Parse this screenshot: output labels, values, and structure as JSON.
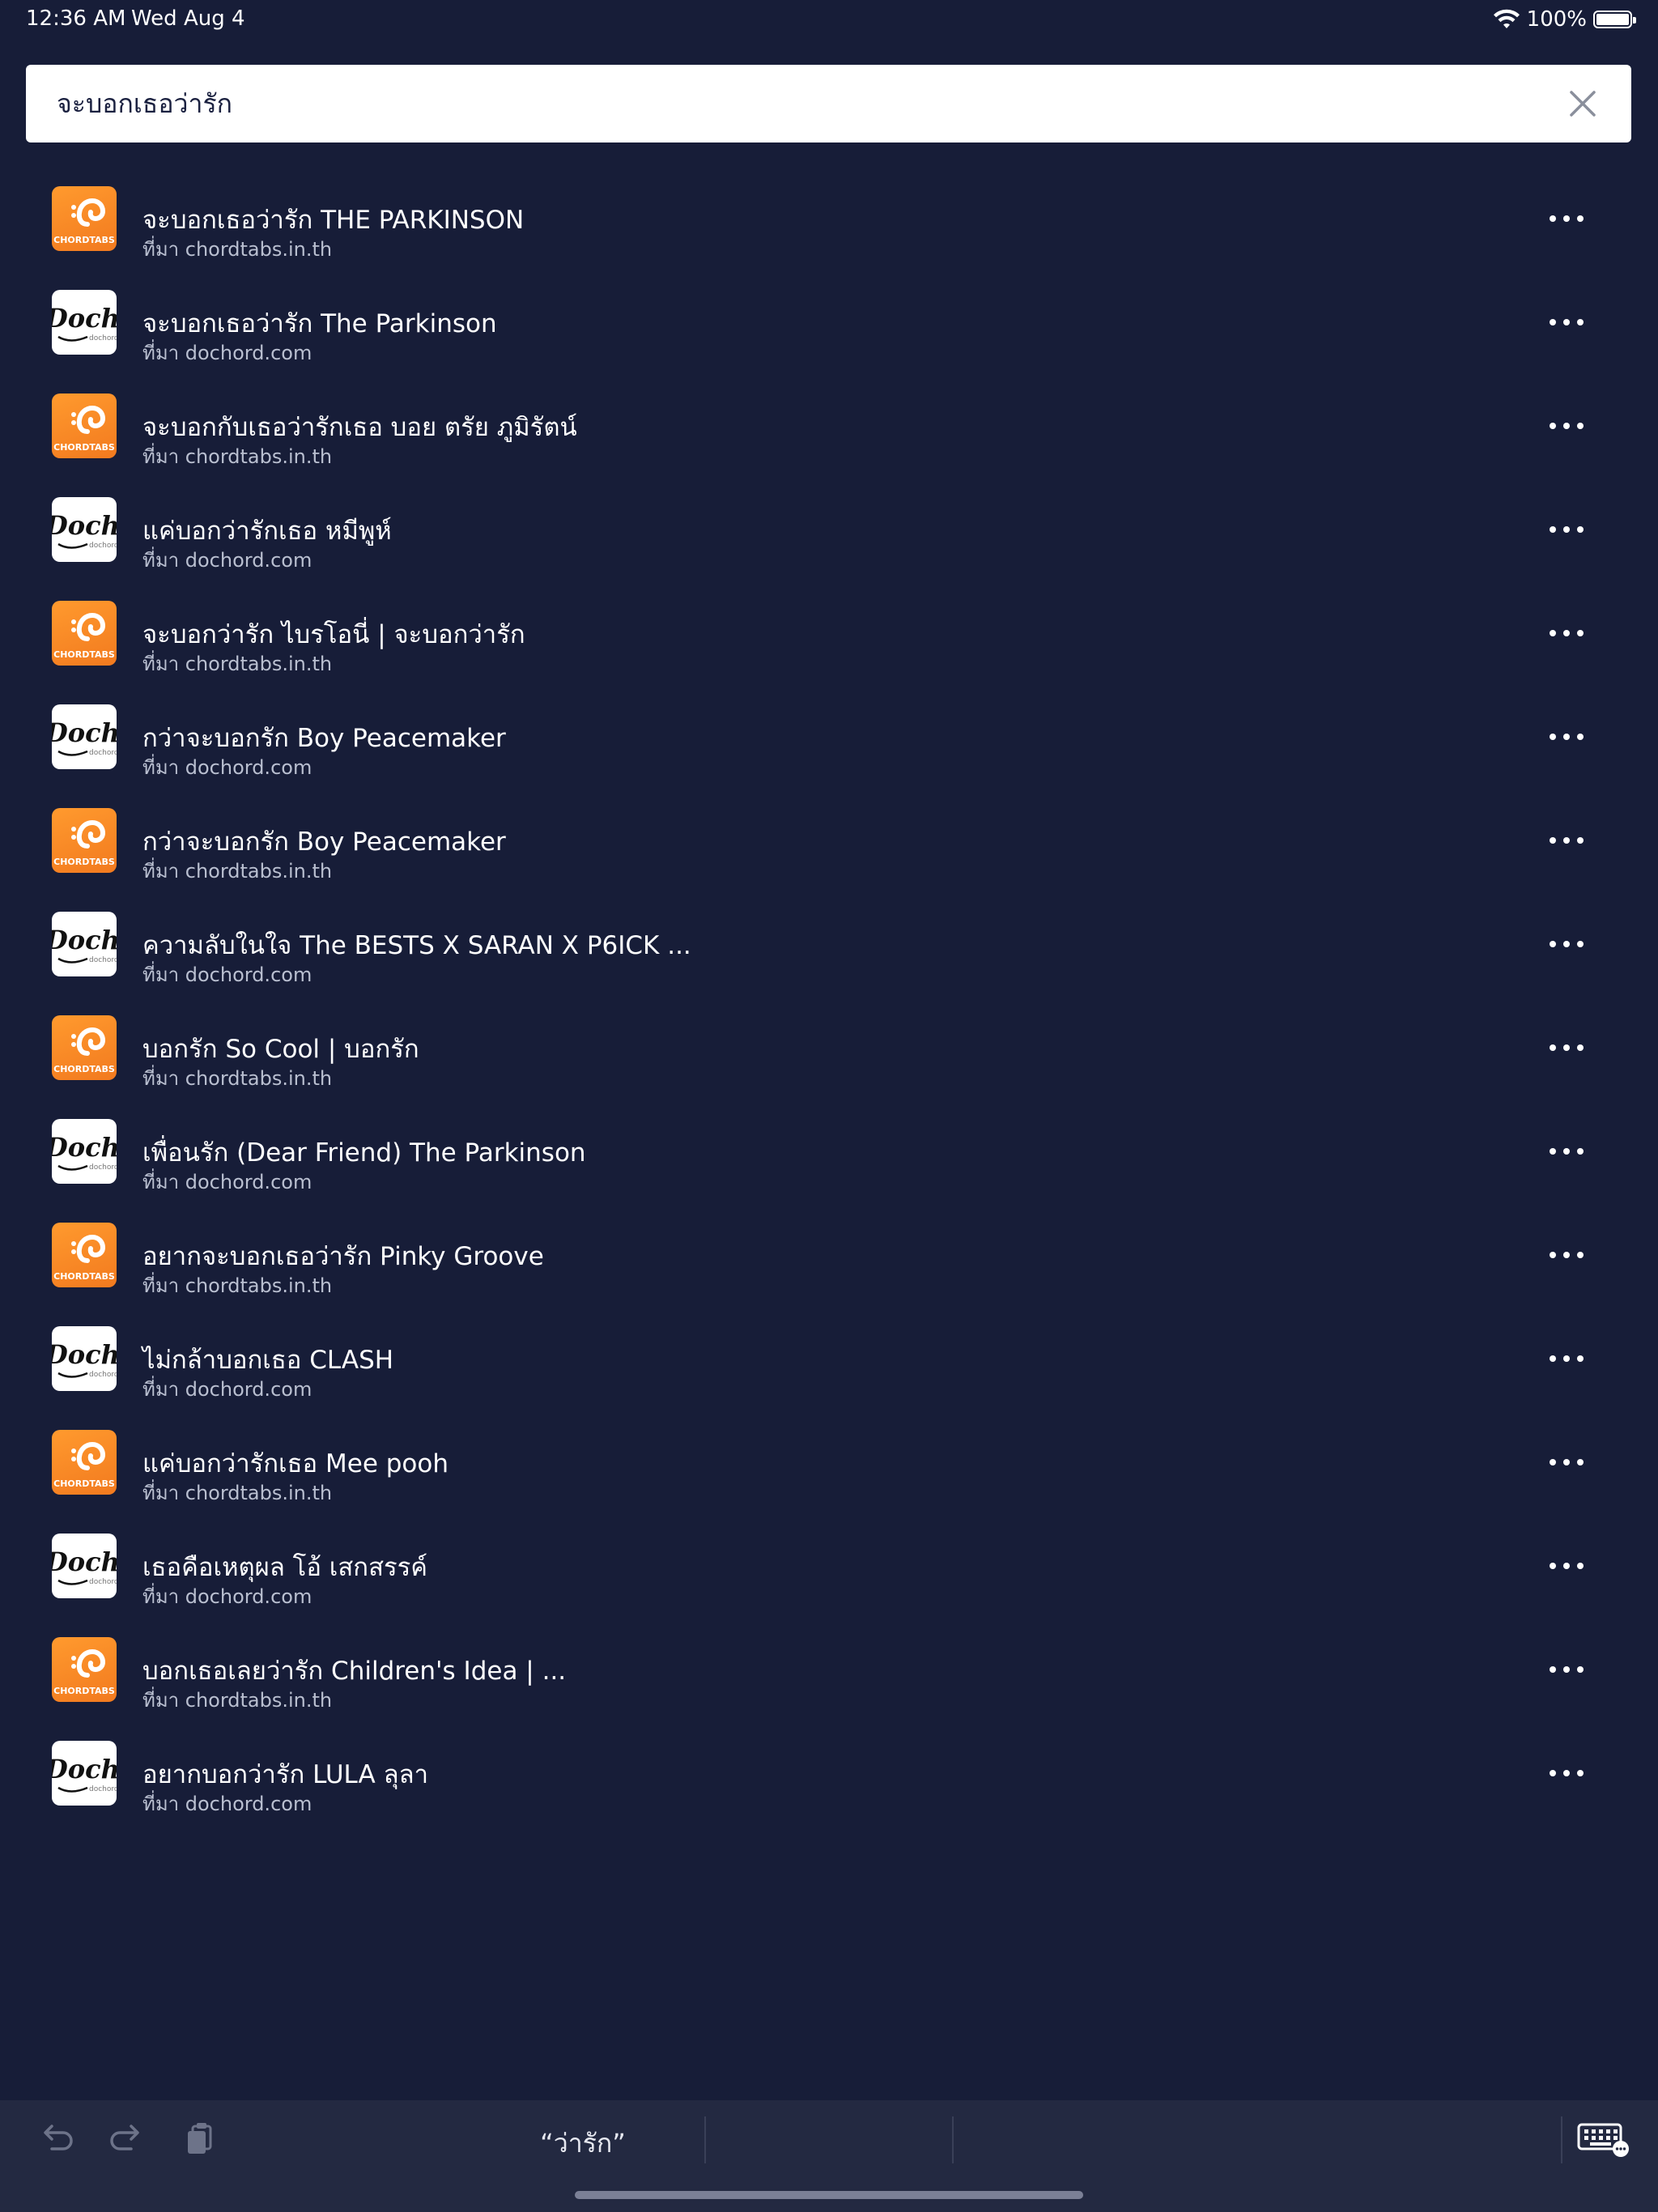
{
  "status_bar": {
    "time": "12:36 AM",
    "date": "Wed Aug 4",
    "battery": "100%",
    "battery_level": 1.0
  },
  "search": {
    "query": "จะบอกเธอว่ารัก",
    "clear_icon": "close-icon"
  },
  "results": [
    {
      "title": "จะบอกเธอว่ารัก THE PARKINSON",
      "source": "ที่มา chordtabs.in.th",
      "site": "chordtabs"
    },
    {
      "title": "จะบอกเธอว่ารัก The Parkinson",
      "source": "ที่มา dochord.com",
      "site": "dochord"
    },
    {
      "title": "จะบอกกับเธอว่ารักเธอ บอย ตรัย ภูมิรัตน์",
      "source": "ที่มา chordtabs.in.th",
      "site": "chordtabs"
    },
    {
      "title": "แค่บอกว่ารักเธอ หมีพูห์",
      "source": "ที่มา dochord.com",
      "site": "dochord"
    },
    {
      "title": "จะบอกว่ารัก ไบรโอนี่ | จะบอกว่ารัก",
      "source": "ที่มา chordtabs.in.th",
      "site": "chordtabs"
    },
    {
      "title": "กว่าจะบอกรัก Boy Peacemaker",
      "source": "ที่มา dochord.com",
      "site": "dochord"
    },
    {
      "title": "กว่าจะบอกรัก Boy Peacemaker",
      "source": "ที่มา chordtabs.in.th",
      "site": "chordtabs"
    },
    {
      "title": "ความลับในใจ The BESTS X SARAN X P6ICK ...",
      "source": "ที่มา dochord.com",
      "site": "dochord"
    },
    {
      "title": "บอกรัก So Cool | บอกรัก",
      "source": "ที่มา chordtabs.in.th",
      "site": "chordtabs"
    },
    {
      "title": "เพื่อนรัก (Dear Friend) The Parkinson",
      "source": "ที่มา dochord.com",
      "site": "dochord"
    },
    {
      "title": "อยากจะบอกเธอว่ารัก Pinky Groove",
      "source": "ที่มา chordtabs.in.th",
      "site": "chordtabs"
    },
    {
      "title": "ไม่กล้าบอกเธอ CLASH",
      "source": "ที่มา dochord.com",
      "site": "dochord"
    },
    {
      "title": "แค่บอกว่ารักเธอ Mee pooh",
      "source": "ที่มา chordtabs.in.th",
      "site": "chordtabs"
    },
    {
      "title": "เธอคือเหตุผล โอ้ เสกสรรค์",
      "source": "ที่มา dochord.com",
      "site": "dochord"
    },
    {
      "title": "บอกเธอเลยว่ารัก Children's Idea | ...",
      "source": "ที่มา chordtabs.in.th",
      "site": "chordtabs"
    },
    {
      "title": "อยากบอกว่ารัก LULA ลุลา",
      "source": "ที่มา dochord.com",
      "site": "dochord"
    }
  ],
  "logos": {
    "chordtabs_label": "CHORDTABS",
    "dochord_label": "Dochord",
    "dochord_sublabel": "dochord"
  },
  "keyboard_bar": {
    "suggestion": "“ว่ารัก”",
    "undo_icon": "undo-icon",
    "redo_icon": "redo-icon",
    "paste_icon": "clipboard-icon",
    "keyboard_icon": "keyboard-icon"
  },
  "colors": {
    "background": "#171d38",
    "chordtabs_orange": "#f7861f",
    "caret": "#e0218a"
  }
}
